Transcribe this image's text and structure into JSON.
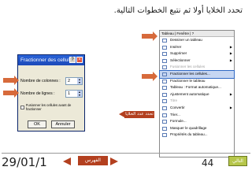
{
  "slide": {
    "title": "تحدد الخلايا أولا ثم نتبع الخطوات التالية."
  },
  "dialog": {
    "title": "Fractionner des cellules",
    "columns_label": "Nombre de colonnes :",
    "columns_value": "2",
    "rows_label": "Nombre de lignes :",
    "rows_value": "1",
    "merge_label": "Fusionner les cellules avant de fractionner",
    "ok_label": "OK",
    "cancel_label": "Annuler"
  },
  "callout": {
    "text": "تحدد عدد الخلايا"
  },
  "menu": {
    "header": "Tableau | Fenêtre | ?",
    "items": [
      {
        "label": "Dessiner un tableau",
        "dim": false,
        "submenu": false,
        "selected": false
      },
      {
        "label": "Insérer",
        "dim": false,
        "submenu": true,
        "selected": false
      },
      {
        "label": "Supprimer",
        "dim": false,
        "submenu": true,
        "selected": false
      },
      {
        "label": "Sélectionner",
        "dim": false,
        "submenu": true,
        "selected": false
      },
      {
        "label": "Fusionner les cellules",
        "dim": true,
        "submenu": false,
        "selected": false
      },
      {
        "label": "Fractionner les cellules...",
        "dim": false,
        "submenu": false,
        "selected": true
      },
      {
        "label": "Fractionner le tableau",
        "dim": false,
        "submenu": false,
        "selected": false
      },
      {
        "label": "Tableau : Format automatique...",
        "dim": false,
        "submenu": false,
        "selected": false
      },
      {
        "label": "Ajustement automatique",
        "dim": false,
        "submenu": true,
        "selected": false
      },
      {
        "label": "Titre",
        "dim": true,
        "submenu": false,
        "selected": false
      },
      {
        "label": "Convertir",
        "dim": false,
        "submenu": true,
        "selected": false
      },
      {
        "label": "Trier...",
        "dim": false,
        "submenu": false,
        "selected": false
      },
      {
        "label": "Formule...",
        "dim": false,
        "submenu": false,
        "selected": false
      },
      {
        "label": "Masquer le quadrillage",
        "dim": false,
        "submenu": false,
        "selected": false
      },
      {
        "label": "Propriétés du tableau...",
        "dim": false,
        "submenu": false,
        "selected": false
      }
    ]
  },
  "footer": {
    "date": "29/01/1",
    "index_label": "الفهرس",
    "page_number": "44",
    "next_label": "التالي"
  },
  "colors": {
    "accent": "#b3401f",
    "arrow": "#d76a3b",
    "next_button": "#b6c64a",
    "selection": "#c6d6f2"
  }
}
